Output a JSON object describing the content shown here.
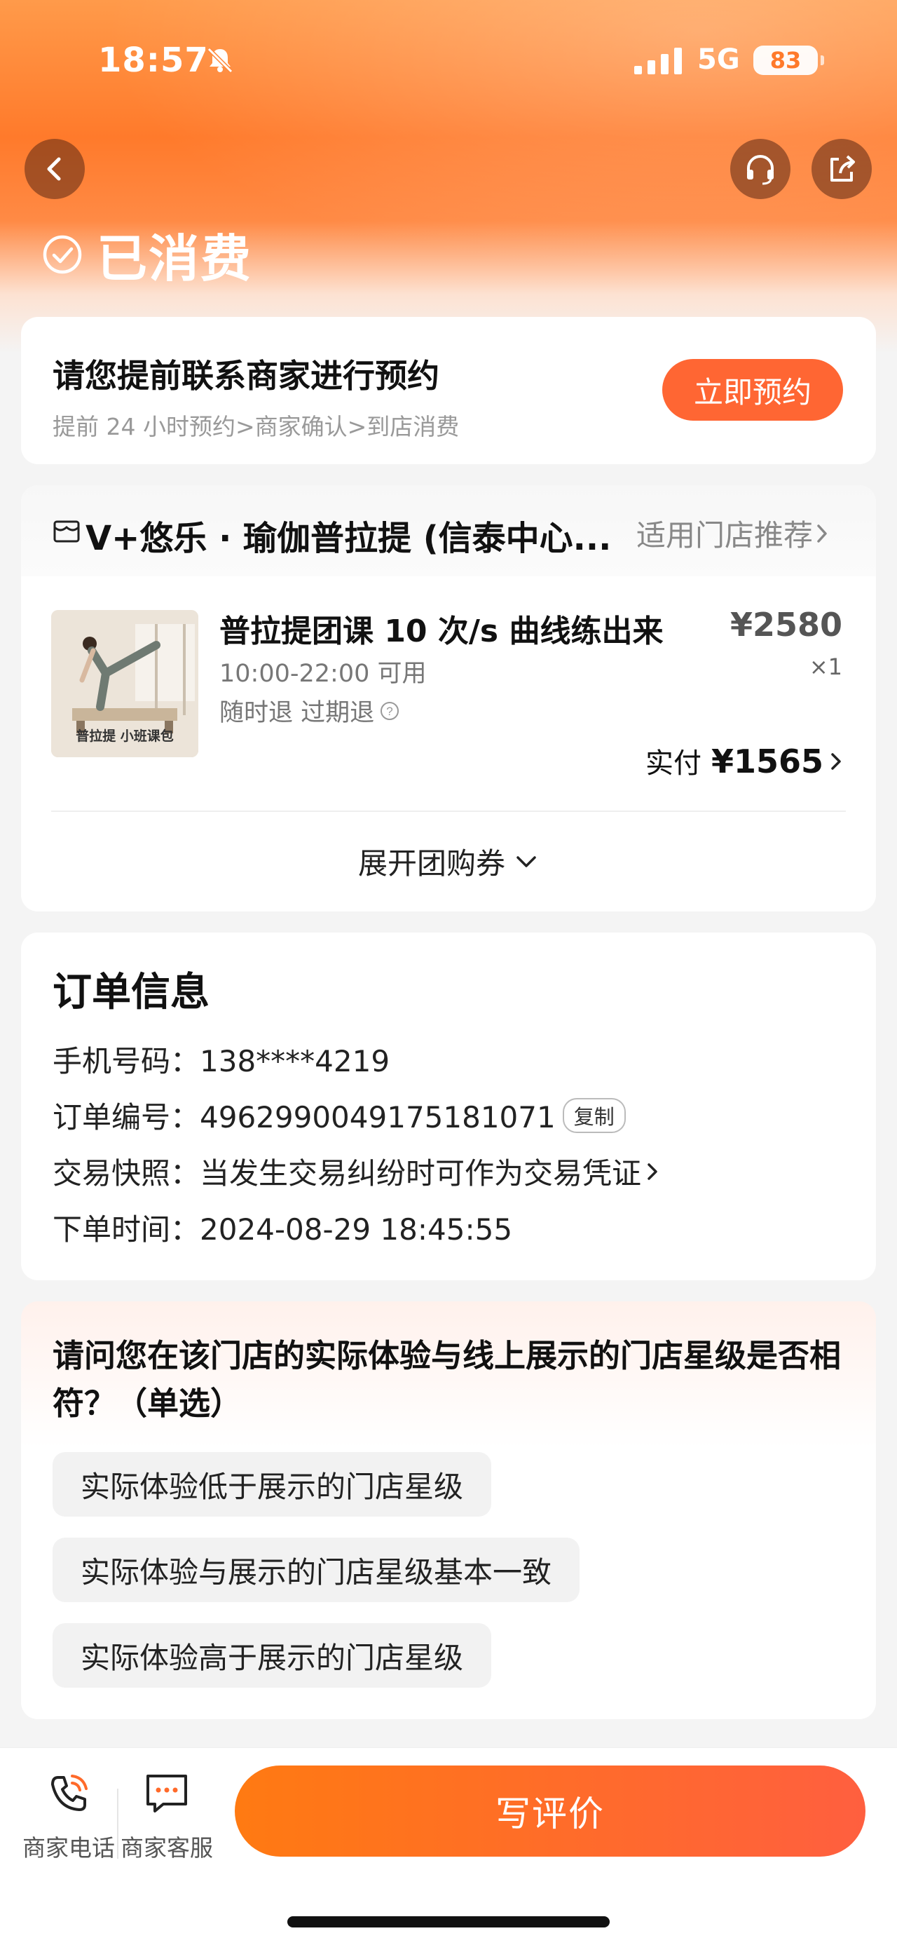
{
  "status_bar": {
    "time": "18:57",
    "network": "5G",
    "battery": "83"
  },
  "header": {
    "status_text": "已消费"
  },
  "booking": {
    "title": "请您提前联系商家进行预约",
    "subtitle": "提前 24 小时预约>商家确认>到店消费",
    "button": "立即预约"
  },
  "product": {
    "store_name": "V+悠乐 · 瑜伽普拉提 (信泰中心...",
    "store_link": "适用门店推荐",
    "thumb_caption": "普拉提 小班课包",
    "title": "普拉提团课 10 次/s 曲线练出来",
    "time": "10:00-22:00 可用",
    "refund": "随时退 过期退",
    "price": "¥2580",
    "qty": "×1",
    "paid_label": "实付",
    "paid_value": "¥1565",
    "expand": "展开团购券"
  },
  "order": {
    "title": "订单信息",
    "phone": "手机号码：138****4219",
    "number": "订单编号：4962990049175181071",
    "copy": "复制",
    "snapshot": "交易快照：当发生交易纠纷时可作为交易凭证",
    "time": "下单时间：2024-08-29 18:45:55"
  },
  "survey": {
    "question": "请问您在该门店的实际体验与线上展示的门店星级是否相符？（单选）",
    "options": [
      "实际体验低于展示的门店星级",
      "实际体验与展示的门店星级基本一致",
      "实际体验高于展示的门店星级"
    ]
  },
  "bottom": {
    "phone": "商家电话",
    "service": "商家客服",
    "review": "写评价"
  },
  "colors": {
    "accent": "#ff6633",
    "brand": "#ff7a2b"
  }
}
